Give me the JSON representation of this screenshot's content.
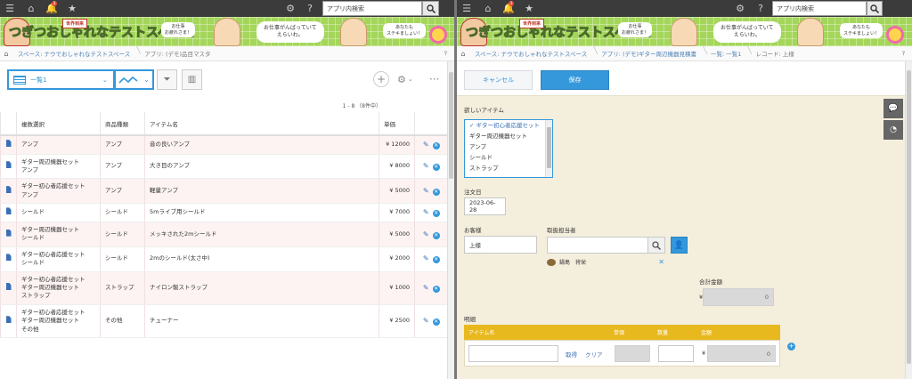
{
  "left": {
    "topbar": {
      "search_placeholder": "アプリ内検索",
      "notification_count": "3"
    },
    "banner": {
      "title": "つぎつおしゃれなテストスペース",
      "tag": "世界到来",
      "bubble1": "お仕事がんばっていて\nえらいわ。",
      "bubble2": "お仕事\nお疲れさま！",
      "bubble3": "あなたも\nステキましょい！"
    },
    "breadcrumb": [
      "スペース: ナウでおしゃれなテストスペース",
      "アプリ: (デモ)品目マスタ"
    ],
    "view": {
      "label": "一覧1"
    },
    "pager": "1 - 8 （8件中）",
    "table": {
      "headers": [
        "複数選択",
        "商品種類",
        "アイテム名",
        "単価"
      ],
      "rows": [
        {
          "multi": "アンプ",
          "kind": "アンプ",
          "item": "音の良いアンプ",
          "price": "¥ 12000"
        },
        {
          "multi": "ギター周辺機器セット\nアンプ",
          "kind": "アンプ",
          "item": "大き目のアンプ",
          "price": "¥ 8000"
        },
        {
          "multi": "ギター初心者応援セット\nアンプ",
          "kind": "アンプ",
          "item": "軽量アンプ",
          "price": "¥ 5000"
        },
        {
          "multi": "シールド",
          "kind": "シールド",
          "item": "5mライブ用シールド",
          "price": "¥ 7000"
        },
        {
          "multi": "ギター周辺機器セット\nシールド",
          "kind": "シールド",
          "item": "メッキされた2mシールド",
          "price": "¥ 5000"
        },
        {
          "multi": "ギター初心者応援セット\nシールド",
          "kind": "シールド",
          "item": "2mのシールド(太さ中)",
          "price": "¥ 2000"
        },
        {
          "multi": "ギター初心者応援セット\nギター周辺機器セット\nストラップ",
          "kind": "ストラップ",
          "item": "ナイロン製ストラップ",
          "price": "¥ 1000"
        },
        {
          "multi": "ギター初心者応援セット\nギター周辺機器セット\nその他",
          "kind": "その他",
          "item": "チューナー",
          "price": "¥ 2500"
        }
      ]
    }
  },
  "right": {
    "topbar": {
      "search_placeholder": "アプリ内検索",
      "notification_count": "3"
    },
    "breadcrumb": [
      "スペース: ナウでおしゃれなテストスペース",
      "アプリ: (デモ)ギター周辺機器見積書",
      "一覧: 一覧1",
      "レコード: 上様"
    ],
    "buttons": {
      "cancel": "キャンセル",
      "save": "保存"
    },
    "form": {
      "wanted_label": "欲しいアイテム",
      "wanted_options": [
        "✓ ギター初心者応援セット",
        "ギター周辺機器セット",
        "アンプ",
        "シールド",
        "ストラップ"
      ],
      "order_date_label": "注文日",
      "order_date": "2023-06-28",
      "customer_label": "お客様",
      "customer": "上様",
      "staff_label": "取扱担当者",
      "staff_value": "鍋島　将栄",
      "total_label": "合計金額",
      "total_currency": "¥",
      "total_value": "0",
      "detail_label": "明細",
      "subtable_headers": [
        "アイテム名",
        "単価",
        "数量",
        "金額"
      ],
      "lookup_get": "取得",
      "lookup_clear": "クリア",
      "amount_currency": "¥",
      "amount_value": "0"
    }
  }
}
